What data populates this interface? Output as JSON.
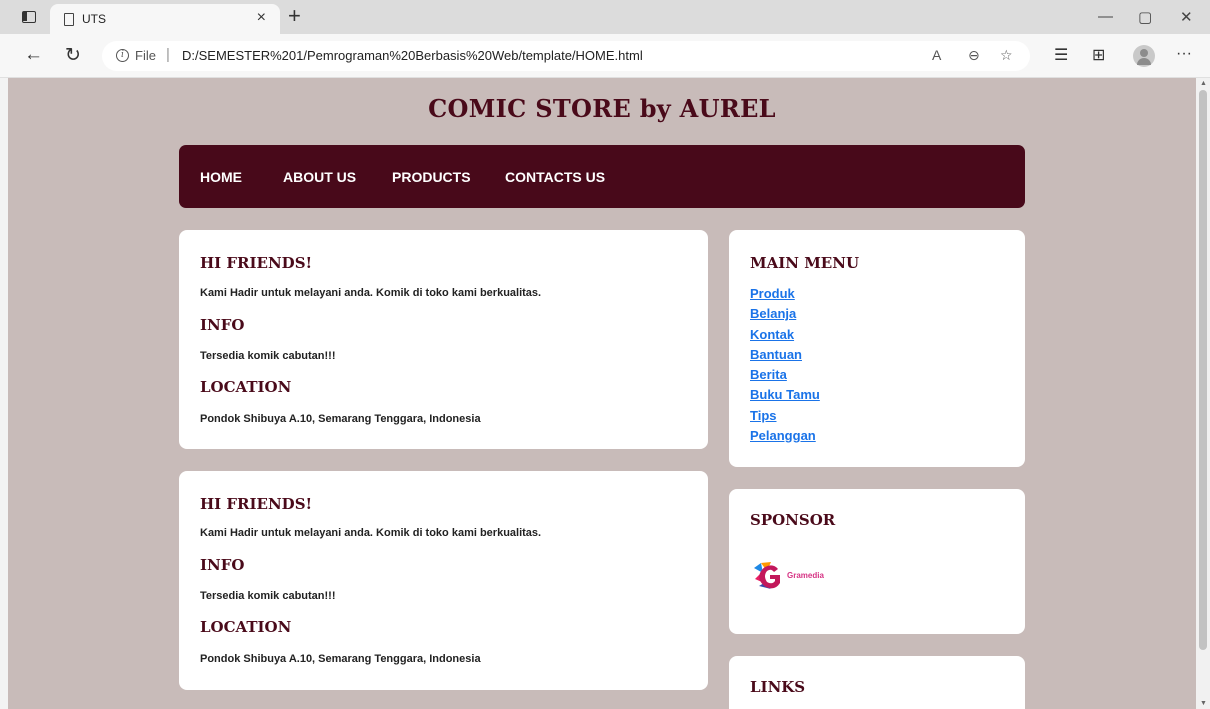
{
  "browser": {
    "tab_title": "UTS",
    "url_scheme": "File",
    "url": "D:/SEMESTER%201/Pemrograman%20Berbasis%20Web/template/HOME.html"
  },
  "site": {
    "title": "COMIC STORE by AUREL"
  },
  "nav": {
    "items": [
      "HOME",
      "ABOUT US",
      "PRODUCTS",
      "CONTACTS US"
    ]
  },
  "content_cards": [
    {
      "greeting_heading": "HI FRIENDS!",
      "greeting_text": "Kami Hadir untuk melayani anda. Komik di toko kami berkualitas.",
      "info_heading": "INFO",
      "info_text": "Tersedia komik cabutan!!!",
      "location_heading": "LOCATION",
      "location_text": "Pondok Shibuya A.10, Semarang Tenggara, Indonesia"
    },
    {
      "greeting_heading": "HI FRIENDS!",
      "greeting_text": "Kami Hadir untuk melayani anda. Komik di toko kami berkualitas.",
      "info_heading": "INFO",
      "info_text": "Tersedia komik cabutan!!!",
      "location_heading": "LOCATION",
      "location_text": "Pondok Shibuya A.10, Semarang Tenggara, Indonesia"
    }
  ],
  "sidebar": {
    "main_menu": {
      "heading": "MAIN MENU",
      "links": [
        "Produk",
        "Belanja",
        "Kontak",
        "Bantuan",
        "Berita",
        "Buku Tamu",
        "Tips",
        "Pelanggan"
      ]
    },
    "sponsor": {
      "heading": "SPONSOR",
      "brand": "Gramedia"
    },
    "links": {
      "heading": "LINKS"
    }
  },
  "colors": {
    "page_bg": "#c8bbb9",
    "nav_bg": "#48091a",
    "heading": "#4a0a1a",
    "link": "#1a73e8"
  }
}
